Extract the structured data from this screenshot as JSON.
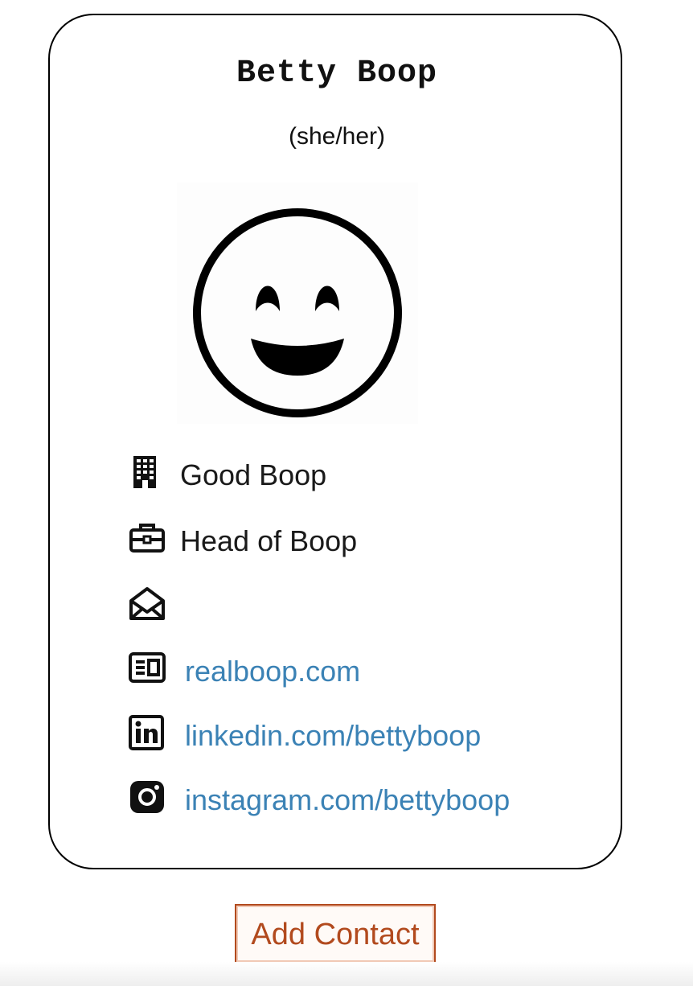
{
  "contact": {
    "name": "Betty Boop",
    "pronouns": "(she/her)",
    "avatar_icon": "smiling-face-icon",
    "company": "Good Boop",
    "title": "Head of Boop",
    "email": "",
    "website": "realboop.com",
    "linkedin": "linkedin.com/bettyboop",
    "instagram": "instagram.com/bettyboop"
  },
  "icons": {
    "company": "building-icon",
    "title": "briefcase-icon",
    "email": "envelope-open-icon",
    "website": "id-card-icon",
    "linkedin": "linkedin-icon",
    "instagram": "instagram-icon"
  },
  "actions": {
    "add_contact_label": "Add Contact"
  },
  "colors": {
    "link": "#3b82b5",
    "button_accent": "#b24a1e"
  }
}
